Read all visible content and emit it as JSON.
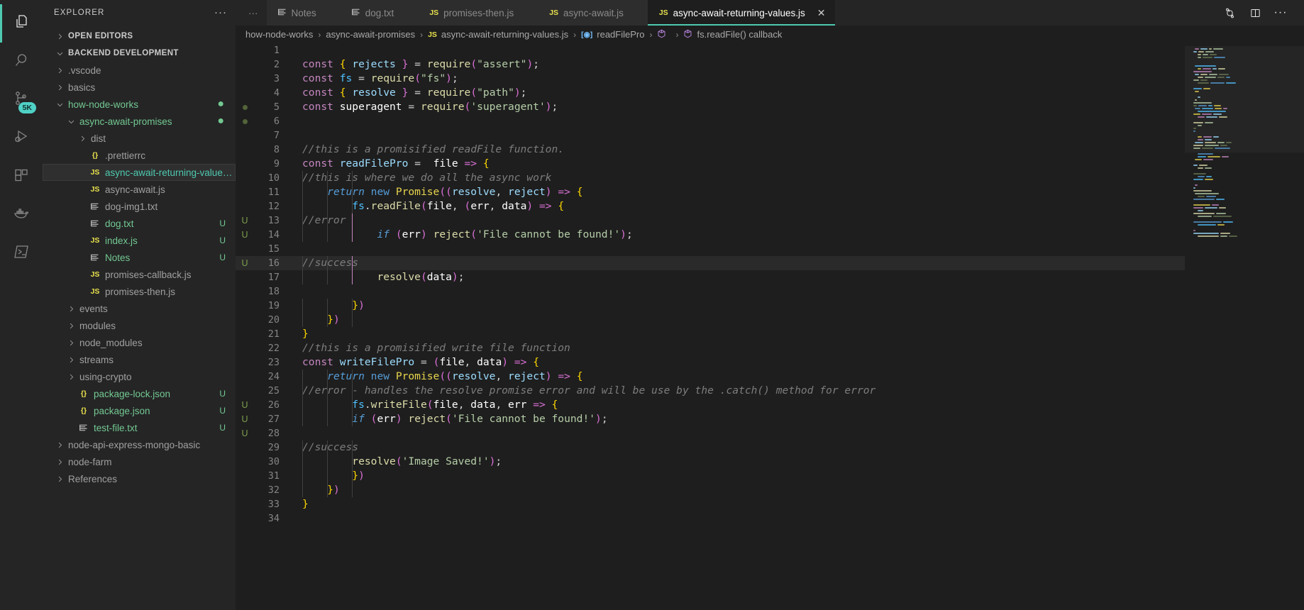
{
  "activitybar": {
    "items": [
      {
        "name": "explorer",
        "icon": "files-icon",
        "active": true,
        "badge": null
      },
      {
        "name": "search",
        "icon": "search-icon",
        "active": false,
        "badge": null
      },
      {
        "name": "source-control",
        "icon": "source-control-icon",
        "active": false,
        "badge": "5K"
      },
      {
        "name": "run-and-debug",
        "icon": "run-debug-icon",
        "active": false,
        "badge": null
      },
      {
        "name": "extensions",
        "icon": "extensions-icon",
        "active": false,
        "badge": null
      },
      {
        "name": "docker",
        "icon": "docker-icon",
        "active": false,
        "badge": null
      },
      {
        "name": "terminal",
        "icon": "terminal-icon",
        "active": false,
        "badge": null
      }
    ]
  },
  "sidebar": {
    "title": "EXPLORER",
    "more_label": "···",
    "sections": [
      {
        "label": "OPEN EDITORS",
        "expanded": false
      },
      {
        "label": "BACKEND DEVELOPMENT",
        "expanded": true
      }
    ],
    "tree": [
      {
        "label": ".vscode",
        "type": "folder",
        "indent": 1,
        "expanded": false,
        "color": "dim",
        "status": "",
        "selected": false
      },
      {
        "label": "basics",
        "type": "folder",
        "indent": 1,
        "expanded": false,
        "color": "dim",
        "status": "",
        "selected": false
      },
      {
        "label": "how-node-works",
        "type": "folder",
        "indent": 1,
        "expanded": true,
        "color": "green",
        "status": "dot",
        "selected": false
      },
      {
        "label": "async-await-promises",
        "type": "folder",
        "indent": 2,
        "expanded": true,
        "color": "green",
        "status": "dot",
        "selected": false
      },
      {
        "label": "dist",
        "type": "folder",
        "indent": 3,
        "expanded": false,
        "color": "dim",
        "status": "",
        "selected": false
      },
      {
        "label": ".prettierrc",
        "type": "json",
        "indent": 3,
        "color": "dim",
        "status": "",
        "selected": false
      },
      {
        "label": "async-await-returning-values.js",
        "type": "js",
        "indent": 3,
        "color": "sel",
        "status": "",
        "selected": true
      },
      {
        "label": "async-await.js",
        "type": "js",
        "indent": 3,
        "color": "dim",
        "status": "",
        "selected": false
      },
      {
        "label": "dog-img1.txt",
        "type": "txt",
        "indent": 3,
        "color": "dim",
        "status": "",
        "selected": false
      },
      {
        "label": "dog.txt",
        "type": "txt",
        "indent": 3,
        "color": "green",
        "status": "U",
        "selected": false
      },
      {
        "label": "index.js",
        "type": "js",
        "indent": 3,
        "color": "green",
        "status": "U",
        "selected": false
      },
      {
        "label": "Notes",
        "type": "txt",
        "indent": 3,
        "color": "green",
        "status": "U",
        "selected": false
      },
      {
        "label": "promises-callback.js",
        "type": "js",
        "indent": 3,
        "color": "dim",
        "status": "",
        "selected": false
      },
      {
        "label": "promises-then.js",
        "type": "js",
        "indent": 3,
        "color": "dim",
        "status": "",
        "selected": false
      },
      {
        "label": "events",
        "type": "folder",
        "indent": 2,
        "expanded": false,
        "color": "dim",
        "status": "",
        "selected": false
      },
      {
        "label": "modules",
        "type": "folder",
        "indent": 2,
        "expanded": false,
        "color": "dim",
        "status": "",
        "selected": false
      },
      {
        "label": "node_modules",
        "type": "folder",
        "indent": 2,
        "expanded": false,
        "color": "dim",
        "status": "",
        "selected": false
      },
      {
        "label": "streams",
        "type": "folder",
        "indent": 2,
        "expanded": false,
        "color": "dim",
        "status": "",
        "selected": false
      },
      {
        "label": "using-crypto",
        "type": "folder",
        "indent": 2,
        "expanded": false,
        "color": "dim",
        "status": "",
        "selected": false
      },
      {
        "label": "package-lock.json",
        "type": "json",
        "indent": 2,
        "color": "green",
        "status": "U",
        "selected": false
      },
      {
        "label": "package.json",
        "type": "json",
        "indent": 2,
        "color": "green",
        "status": "U",
        "selected": false
      },
      {
        "label": "test-file.txt",
        "type": "txt",
        "indent": 2,
        "color": "green",
        "status": "U",
        "selected": false
      },
      {
        "label": "node-api-express-mongo-basic",
        "type": "folder",
        "indent": 1,
        "expanded": false,
        "color": "dim",
        "status": "",
        "selected": false
      },
      {
        "label": "node-farm",
        "type": "folder",
        "indent": 1,
        "expanded": false,
        "color": "dim",
        "status": "",
        "selected": false
      },
      {
        "label": "References",
        "type": "folder",
        "indent": 1,
        "expanded": false,
        "color": "dim",
        "status": "",
        "selected": false
      }
    ]
  },
  "tabs": {
    "overflow_label": "···",
    "items": [
      {
        "label": "Notes",
        "icon": "txt",
        "active": false
      },
      {
        "label": "dog.txt",
        "icon": "txt",
        "active": false
      },
      {
        "label": "promises-then.js",
        "icon": "js",
        "active": false
      },
      {
        "label": "async-await.js",
        "icon": "js",
        "active": false
      },
      {
        "label": "async-await-returning-values.js",
        "icon": "js",
        "active": true,
        "close": "✕"
      }
    ],
    "actions": [
      {
        "name": "split-compare-icon"
      },
      {
        "name": "split-editor-icon"
      },
      {
        "name": "more-actions-icon",
        "label": "···"
      }
    ]
  },
  "breadcrumbs": [
    {
      "label": "how-node-works",
      "icon": ""
    },
    {
      "label": "async-await-promises",
      "icon": ""
    },
    {
      "label": "async-await-returning-values.js",
      "icon": "js"
    },
    {
      "label": "readFilePro",
      "icon": "field"
    },
    {
      "label": "<function>",
      "icon": "function"
    },
    {
      "label": "fs.readFile() callback",
      "icon": "function"
    }
  ],
  "editor": {
    "highlighted_line": 16,
    "gutter": [
      {
        "line": 5,
        "marker": "dot"
      },
      {
        "line": 6,
        "marker": "dot"
      }
    ],
    "lines": [
      {
        "n": 1,
        "text": ""
      },
      {
        "n": 2,
        "text": "const { rejects } = require(\"assert\");"
      },
      {
        "n": 3,
        "text": "const fs = require(\"fs\");"
      },
      {
        "n": 4,
        "text": "const { resolve } = require(\"path\");"
      },
      {
        "n": 5,
        "text": "const superagent = require('superagent');"
      },
      {
        "n": 6,
        "text": ""
      },
      {
        "n": 7,
        "text": ""
      },
      {
        "n": 8,
        "text": "//this is a promisified readFile function."
      },
      {
        "n": 9,
        "text": "const readFilePro =  file => {"
      },
      {
        "n": 10,
        "text": "    //this is where we do all the async work"
      },
      {
        "n": 11,
        "text": "    return new Promise((resolve, reject) => {"
      },
      {
        "n": 12,
        "text": "        fs.readFile(file, (err, data) => {"
      },
      {
        "n": 13,
        "text": "            //error"
      },
      {
        "n": 14,
        "text": "            if (err) reject('File cannot be found!');"
      },
      {
        "n": 15,
        "text": ""
      },
      {
        "n": 16,
        "text": "            //success"
      },
      {
        "n": 17,
        "text": "            resolve(data);"
      },
      {
        "n": 18,
        "text": ""
      },
      {
        "n": 19,
        "text": "        })"
      },
      {
        "n": 20,
        "text": "    })"
      },
      {
        "n": 21,
        "text": "}"
      },
      {
        "n": 22,
        "text": "//this is a promisified write file function"
      },
      {
        "n": 23,
        "text": "const writeFilePro = (file, data) => {"
      },
      {
        "n": 24,
        "text": "    return new Promise((resolve, reject) => {"
      },
      {
        "n": 25,
        "text": "        //error - handles the resolve promise error and will be use by the .catch() method for error"
      },
      {
        "n": 26,
        "text": "        fs.writeFile(file, data, err => {"
      },
      {
        "n": 27,
        "text": "        if (err) reject('File cannot be found!');"
      },
      {
        "n": 28,
        "text": ""
      },
      {
        "n": 29,
        "text": "        //success"
      },
      {
        "n": 30,
        "text": "        resolve('Image Saved!');"
      },
      {
        "n": 31,
        "text": "        })"
      },
      {
        "n": 32,
        "text": "    })"
      },
      {
        "n": 33,
        "text": "}"
      },
      {
        "n": 34,
        "text": ""
      }
    ]
  },
  "colors": {
    "accent": "#4ec9b0",
    "editor_bg": "#1e1e1e",
    "sidebar_bg": "#252526",
    "activitybar_bg": "#252526",
    "tab_inactive_bg": "#2d2d2d",
    "badge_bg": "#4fd1c5",
    "git_untracked": "#73c991",
    "line_highlight": "#2a2a2a"
  }
}
